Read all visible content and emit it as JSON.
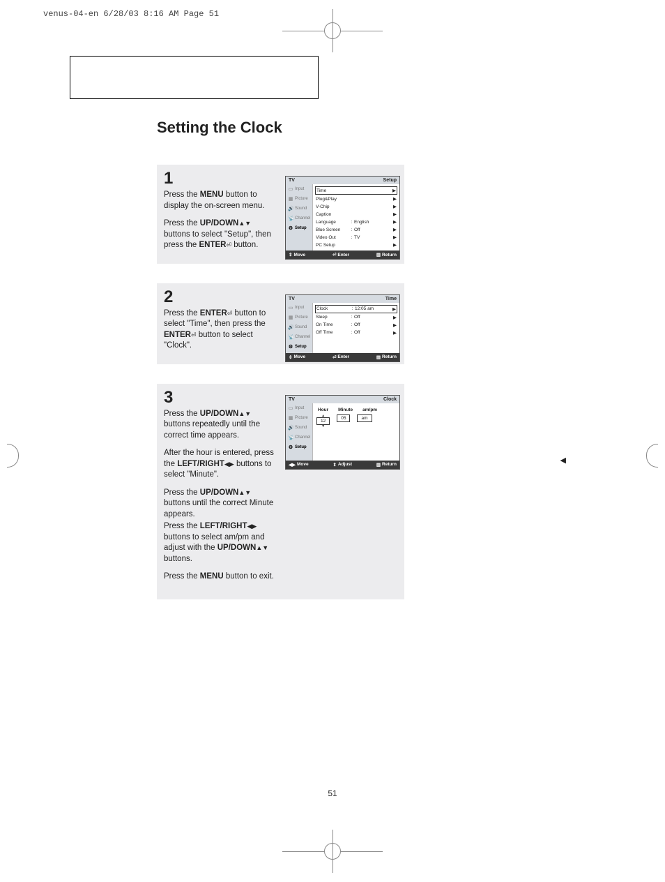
{
  "header_slug": "venus-04-en  6/28/03  8:16 AM  Page 51",
  "title": "Setting the Clock",
  "page_number": "51",
  "steps": {
    "s1": {
      "num": "1",
      "p1a": "Press the ",
      "p1b": "MENU",
      "p1c": " button to display the on-screen menu.",
      "p2a": "Press the ",
      "p2b": "UP/DOWN",
      "p2c": " buttons to select \"Setup\", then press the ",
      "p2d": "ENTER",
      "p2e": " button."
    },
    "s2": {
      "num": "2",
      "p1a": "Press the ",
      "p1b": "ENTER",
      "p1c": " button to select \"Time\", then press the ",
      "p1d": "ENTER",
      "p1e": " button to select \"Clock\"."
    },
    "s3": {
      "num": "3",
      "p1a": "Press the ",
      "p1b": "UP/DOWN",
      "p1c": " buttons repeatedly until the correct time appears.",
      "p2a": "After the hour is entered, press the ",
      "p2b": "LEFT/RIGHT",
      "p2c": " buttons to select \"Minute\".",
      "p3a": "Press the ",
      "p3b": "UP/DOWN",
      "p3c": " buttons until the correct Minute appears.",
      "p4a": "Press the ",
      "p4b": "LEFT/RIGHT",
      "p4c": " buttons to select am/pm and adjust with the ",
      "p4d": "UP/DOWN",
      "p4e": " buttons.",
      "p5a": "Press the ",
      "p5b": "MENU",
      "p5c": " button to exit."
    }
  },
  "osd_side": {
    "tv": "TV",
    "input": "Input",
    "picture": "Picture",
    "sound": "Sound",
    "channel": "Channel",
    "setup": "Setup"
  },
  "osd1": {
    "title_r": "Setup",
    "rows": [
      {
        "lbl": "Time",
        "val": "",
        "sel": true
      },
      {
        "lbl": "Plug&Play",
        "val": ""
      },
      {
        "lbl": "V-Chip",
        "val": ""
      },
      {
        "lbl": "Caption",
        "val": ""
      },
      {
        "lbl": "Language",
        "val": "English",
        "colon": true
      },
      {
        "lbl": "Blue Screen",
        "val": "Off",
        "colon": true
      },
      {
        "lbl": "Video Out",
        "val": "TV",
        "colon": true
      },
      {
        "lbl": "PC Setup",
        "val": ""
      }
    ],
    "foot": {
      "a": "Move",
      "b": "Enter",
      "c": "Return"
    }
  },
  "osd2": {
    "title_r": "Time",
    "rows": [
      {
        "lbl": "Clock",
        "val": "12:05 am",
        "colon": true,
        "sel": true
      },
      {
        "lbl": "Sleep",
        "val": "Off",
        "colon": true
      },
      {
        "lbl": "On Time",
        "val": "Off",
        "colon": true
      },
      {
        "lbl": "Off Time",
        "val": "Off",
        "colon": true
      }
    ],
    "foot": {
      "a": "Move",
      "b": "Enter",
      "c": "Return"
    }
  },
  "osd3": {
    "title_r": "Clock",
    "cols": {
      "hour": "Hour",
      "minute": "Minute",
      "ampm": "am/pm"
    },
    "vals": {
      "hour": "12",
      "minute": "05",
      "ampm": "am"
    },
    "foot": {
      "a": "Move",
      "b": "Adjust",
      "c": "Return"
    }
  },
  "glyph": {
    "up": "▲",
    "down": "▼",
    "left": "◀",
    "right": "▶",
    "updown": "▲▼",
    "leftright": "◀▶",
    "enter": "⏎",
    "menu": "▥",
    "lr": "◀▶",
    "ud": "⇕"
  }
}
